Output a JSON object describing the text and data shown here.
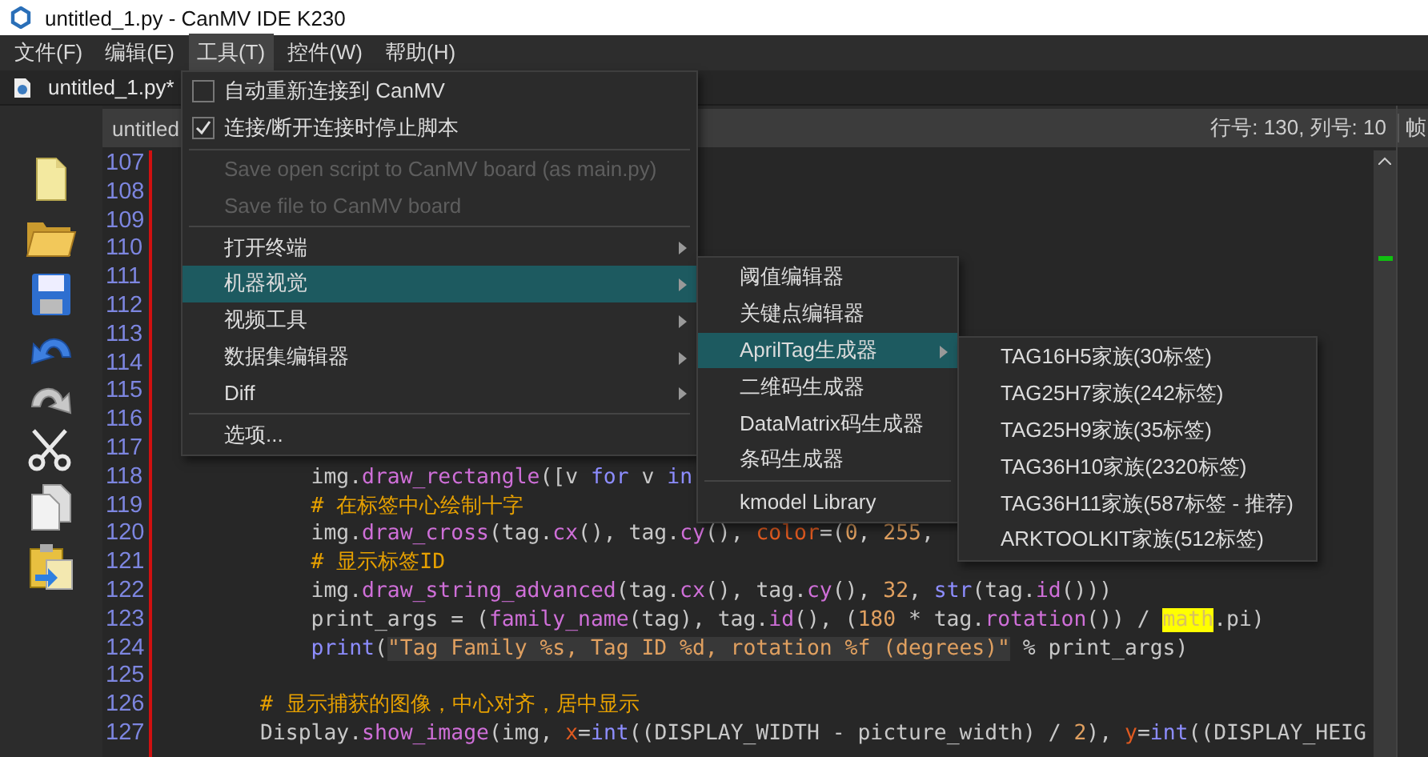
{
  "window": {
    "title": "untitled_1.py - CanMV IDE K230"
  },
  "menu_bar": [
    {
      "label": "文件(F)",
      "selected": false
    },
    {
      "label": "编辑(E)",
      "selected": false
    },
    {
      "label": "工具(T)",
      "selected": true
    },
    {
      "label": "控件(W)",
      "selected": false
    },
    {
      "label": "帮助(H)",
      "selected": false
    }
  ],
  "tabs": [
    {
      "label": "untitled_1.py*",
      "selected": true
    }
  ],
  "editor": {
    "header": "untitled",
    "position": "行号: 130, 列号: 10",
    "header_extra": "帧",
    "lines": [
      {
        "number": "107"
      },
      {
        "number": "108"
      },
      {
        "number": "109"
      },
      {
        "number": "110"
      },
      {
        "number": "111"
      },
      {
        "number": "112"
      },
      {
        "number": "113"
      },
      {
        "number": "114"
      },
      {
        "number": "115"
      },
      {
        "number": "116"
      },
      {
        "number": "117"
      },
      {
        "number": "118",
        "segments": [
          {
            "kind": "plain",
            "text": "            img."
          },
          {
            "kind": "func",
            "text": "draw_rectangle"
          },
          {
            "kind": "plain",
            "text": "([v "
          },
          {
            "kind": "keyword",
            "text": "for"
          },
          {
            "kind": "plain",
            "text": " v "
          },
          {
            "kind": "keyword",
            "text": "in"
          }
        ]
      },
      {
        "number": "119",
        "segments": [
          {
            "kind": "comment",
            "text": "            # 在标签中心绘制十字"
          }
        ]
      },
      {
        "number": "120",
        "segments": [
          {
            "kind": "plain",
            "text": "            img."
          },
          {
            "kind": "func",
            "text": "draw_cross"
          },
          {
            "kind": "plain",
            "text": "(tag."
          },
          {
            "kind": "func",
            "text": "cx"
          },
          {
            "kind": "plain",
            "text": "(), tag."
          },
          {
            "kind": "func",
            "text": "cy"
          },
          {
            "kind": "plain",
            "text": "(), "
          },
          {
            "kind": "param",
            "text": "color"
          },
          {
            "kind": "plain",
            "text": "=("
          },
          {
            "kind": "number",
            "text": "0"
          },
          {
            "kind": "plain",
            "text": ", "
          },
          {
            "kind": "number",
            "text": "255"
          },
          {
            "kind": "plain",
            "text": ","
          }
        ]
      },
      {
        "number": "121",
        "segments": [
          {
            "kind": "comment",
            "text": "            # 显示标签ID"
          }
        ]
      },
      {
        "number": "122",
        "segments": [
          {
            "kind": "plain",
            "text": "            img."
          },
          {
            "kind": "func",
            "text": "draw_string_advanced"
          },
          {
            "kind": "plain",
            "text": "(tag."
          },
          {
            "kind": "func",
            "text": "cx"
          },
          {
            "kind": "plain",
            "text": "(), tag."
          },
          {
            "kind": "func",
            "text": "cy"
          },
          {
            "kind": "plain",
            "text": "(), "
          },
          {
            "kind": "number",
            "text": "32"
          },
          {
            "kind": "plain",
            "text": ", "
          },
          {
            "kind": "builtin",
            "text": "str"
          },
          {
            "kind": "plain",
            "text": "(tag."
          },
          {
            "kind": "func",
            "text": "id"
          },
          {
            "kind": "plain",
            "text": "()))"
          }
        ]
      },
      {
        "number": "123",
        "segments": [
          {
            "kind": "plain",
            "text": "            print_args = ("
          },
          {
            "kind": "func",
            "text": "family_name"
          },
          {
            "kind": "plain",
            "text": "(tag), tag."
          },
          {
            "kind": "func",
            "text": "id"
          },
          {
            "kind": "plain",
            "text": "(), ("
          },
          {
            "kind": "number",
            "text": "180"
          },
          {
            "kind": "plain",
            "text": " * tag."
          },
          {
            "kind": "func",
            "text": "rotation"
          },
          {
            "kind": "plain",
            "text": "()) / "
          },
          {
            "kind": "highlight",
            "text": "math"
          },
          {
            "kind": "plain",
            "text": ".pi)"
          }
        ]
      },
      {
        "number": "124",
        "segments": [
          {
            "kind": "builtin",
            "text": "            print"
          },
          {
            "kind": "plain",
            "text": "("
          },
          {
            "kind": "string",
            "text": "\"Tag Family %s, Tag ID %d, rotation %f (degrees)\""
          },
          {
            "kind": "plain",
            "text": " % print_args)"
          }
        ]
      },
      {
        "number": "125"
      },
      {
        "number": "126",
        "segments": [
          {
            "kind": "comment",
            "text": "        # 显示捕获的图像，中心对齐，居中显示"
          }
        ]
      },
      {
        "number": "127",
        "segments": [
          {
            "kind": "plain",
            "text": "        Display."
          },
          {
            "kind": "func",
            "text": "show_image"
          },
          {
            "kind": "plain",
            "text": "(img, "
          },
          {
            "kind": "param",
            "text": "x"
          },
          {
            "kind": "plain",
            "text": "="
          },
          {
            "kind": "builtin",
            "text": "int"
          },
          {
            "kind": "plain",
            "text": "((DISPLAY_WIDTH - picture_width) / "
          },
          {
            "kind": "number",
            "text": "2"
          },
          {
            "kind": "plain",
            "text": "), "
          },
          {
            "kind": "param",
            "text": "y"
          },
          {
            "kind": "plain",
            "text": "="
          },
          {
            "kind": "builtin",
            "text": "int"
          },
          {
            "kind": "plain",
            "text": "((DISPLAY_HEIG"
          }
        ]
      }
    ]
  },
  "tools_menu": {
    "items": [
      {
        "kind": "check",
        "label": "自动重新连接到 CanMV",
        "checked": false,
        "disabled": false,
        "selected": false
      },
      {
        "kind": "check",
        "label": "连接/断开连接时停止脚本",
        "checked": true,
        "disabled": false,
        "selected": false
      },
      {
        "kind": "separator"
      },
      {
        "kind": "action",
        "label": "Save open script to CanMV board (as main.py)",
        "disabled": true,
        "selected": false
      },
      {
        "kind": "action",
        "label": "Save file to CanMV board",
        "disabled": true,
        "selected": false
      },
      {
        "kind": "separator"
      },
      {
        "kind": "submenu",
        "label": "打开终端",
        "disabled": false,
        "selected": false
      },
      {
        "kind": "submenu",
        "label": "机器视觉",
        "disabled": false,
        "selected": true
      },
      {
        "kind": "submenu",
        "label": "视频工具",
        "disabled": false,
        "selected": false
      },
      {
        "kind": "submenu",
        "label": "数据集编辑器",
        "disabled": false,
        "selected": false
      },
      {
        "kind": "submenu",
        "label": "Diff",
        "disabled": false,
        "selected": false
      },
      {
        "kind": "separator"
      },
      {
        "kind": "action",
        "label": "选项...",
        "disabled": false,
        "selected": false
      }
    ]
  },
  "vision_menu": {
    "items": [
      {
        "kind": "action",
        "label": "阈值编辑器",
        "disabled": false,
        "selected": false
      },
      {
        "kind": "action",
        "label": "关键点编辑器",
        "disabled": false,
        "selected": false
      },
      {
        "kind": "submenu",
        "label": "AprilTag生成器",
        "disabled": false,
        "selected": true
      },
      {
        "kind": "action",
        "label": "二维码生成器",
        "disabled": false,
        "selected": false
      },
      {
        "kind": "action",
        "label": "DataMatrix码生成器",
        "disabled": false,
        "selected": false
      },
      {
        "kind": "action",
        "label": "条码生成器",
        "disabled": false,
        "selected": false
      },
      {
        "kind": "separator"
      },
      {
        "kind": "action",
        "label": "kmodel Library",
        "disabled": false,
        "selected": false
      }
    ]
  },
  "apriltag_menu": {
    "items": [
      {
        "kind": "action",
        "label": "TAG16H5家族(30标签)",
        "disabled": false,
        "selected": false
      },
      {
        "kind": "action",
        "label": "TAG25H7家族(242标签)",
        "disabled": false,
        "selected": false
      },
      {
        "kind": "action",
        "label": "TAG25H9家族(35标签)",
        "disabled": false,
        "selected": false
      },
      {
        "kind": "action",
        "label": "TAG36H10家族(2320标签)",
        "disabled": false,
        "selected": false
      },
      {
        "kind": "action",
        "label": "TAG36H11家族(587标签 - 推荐)",
        "disabled": false,
        "selected": false
      },
      {
        "kind": "action",
        "label": "ARKTOOLKIT家族(512标签)",
        "disabled": false,
        "selected": false
      }
    ]
  }
}
